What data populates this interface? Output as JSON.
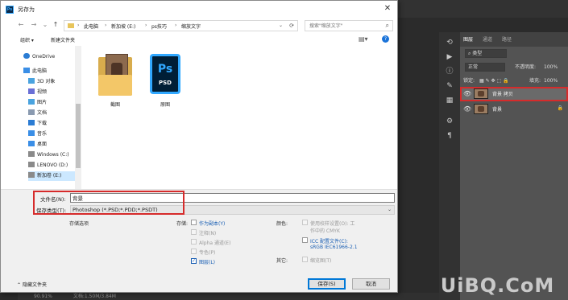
{
  "dialog": {
    "title": "另存为",
    "close_label": "✕"
  },
  "address": {
    "crumbs": [
      "此电脑",
      "新加坡 (E:)",
      "ps技巧",
      "缩放文字"
    ],
    "search_placeholder": "搜索\"缩放文字\""
  },
  "toolbar": {
    "organize_label": "组织 ▾",
    "new_folder_label": "新建文件夹"
  },
  "nav": {
    "items": [
      {
        "label": "OneDrive",
        "icon": "cloud-icon",
        "color": "#2b7cd3"
      },
      {
        "label": "此电脑",
        "icon": "computer-icon",
        "color": "#3a8ee6"
      },
      {
        "label": "3D 对象",
        "icon": "3d-objects-icon",
        "color": "#4aa3df"
      },
      {
        "label": "视频",
        "icon": "video-icon",
        "color": "#6a6fd6"
      },
      {
        "label": "图片",
        "icon": "pictures-icon",
        "color": "#4aa3df"
      },
      {
        "label": "文档",
        "icon": "documents-icon",
        "color": "#8a9ab0"
      },
      {
        "label": "下载",
        "icon": "download-icon",
        "color": "#2b7cd3"
      },
      {
        "label": "音乐",
        "icon": "music-icon",
        "color": "#3a8ee6"
      },
      {
        "label": "桌面",
        "icon": "desktop-icon",
        "color": "#3a8ee6"
      },
      {
        "label": "Windows (C:)",
        "icon": "drive-icon",
        "color": "#8a8a8a"
      },
      {
        "label": "LENOVO (D:)",
        "icon": "drive-icon",
        "color": "#8a8a8a"
      },
      {
        "label": "新加卷 (E:)",
        "icon": "drive-icon",
        "color": "#8a8a8a"
      }
    ]
  },
  "files": [
    {
      "name": "截图",
      "type": "folder"
    },
    {
      "name": "原图",
      "type": "psd",
      "icon_text": "Ps",
      "ext": "PSD"
    }
  ],
  "fields": {
    "filename_label": "文件名(N):",
    "filename_value": "背景",
    "filetype_label": "保存类型(T):",
    "filetype_value": "Photoshop (*.PSD;*.PDD;*.PSDT)"
  },
  "options": {
    "header": "存储选项",
    "save_label": "存储:",
    "save_items": [
      {
        "label": "作为副本(Y)",
        "checked": false,
        "enabled": true
      },
      {
        "label": "注释(N)",
        "checked": false,
        "enabled": false
      },
      {
        "label": "Alpha 通道(E)",
        "checked": false,
        "enabled": false
      },
      {
        "label": "专色(P)",
        "checked": false,
        "enabled": false
      },
      {
        "label": "图层(L)",
        "checked": true,
        "enabled": true
      }
    ],
    "color_label": "颜色:",
    "proof_label": "使用校样设置(O): 工",
    "proof_line2": "作中的 CMYK",
    "icc_label": "ICC 配置文件(C):",
    "icc_value": "sRGB IEC61966-2.1",
    "other_label": "其它:",
    "thumbnail_label": "缩览图(T)"
  },
  "bottom": {
    "hide_folders_label": "隐藏文件夹",
    "save_button": "保存(S)",
    "cancel_button": "取消"
  },
  "photoshop": {
    "panel_tabs": [
      "图层",
      "通道",
      "路径"
    ],
    "filter_label": "类型",
    "blend_mode": "正常",
    "opacity_label": "不透明度:",
    "opacity_value": "100%",
    "lock_label": "锁定:",
    "fill_label": "填充:",
    "fill_value": "100%",
    "layers": [
      {
        "name": "背景 拷贝",
        "selected": true
      },
      {
        "name": "背景",
        "selected": false
      }
    ],
    "status_zoom": "90.91%",
    "status_doc": "文档:1.50M/3.84M"
  },
  "watermark": "UiBQ.CoM",
  "colors": {
    "accent": "#0078d7",
    "highlight_red": "#d62b2b",
    "ps_blue": "#31a8ff"
  }
}
